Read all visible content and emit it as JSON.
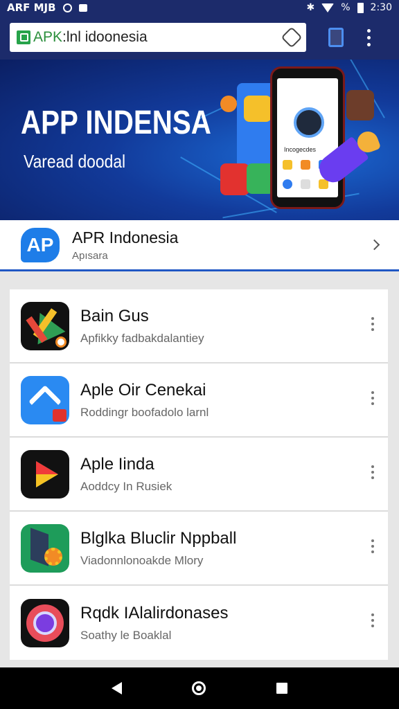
{
  "status": {
    "left_text": "ARF MJB",
    "battery_pct": "%",
    "time": "2:30",
    "icons": [
      "sync-icon",
      "message-icon",
      "bluetooth-icon",
      "wifi-icon",
      "battery-icon"
    ]
  },
  "browser": {
    "url_prefix": "APK",
    "url_text": ":lnl idoonesia",
    "reload_icon": "reload-icon",
    "tabs_icon": "tabs-icon",
    "menu_icon": "more-vertical-icon"
  },
  "hero": {
    "title": "APP INDENSA",
    "subtitle": "Varead doodal",
    "phone_label": "Incogecdes"
  },
  "app_header": {
    "logo_text": "AP",
    "title": "APR Indonesia",
    "subtitle": "Apısara"
  },
  "apps": [
    {
      "title": "Bain Gus",
      "subtitle": "Apfikky fadbakdalantiey",
      "icon": "play-games-icon",
      "colors": [
        "#111111",
        "#f5c02a",
        "#2f9e54",
        "#e5483a"
      ]
    },
    {
      "title": "Aple Oir Cenekai",
      "subtitle": "Roddingr boofadolo larnl",
      "icon": "arrow-up-icon",
      "colors": [
        "#2a8af2",
        "#ffffff",
        "#e0322d"
      ]
    },
    {
      "title": "Aple Iinda",
      "subtitle": "Aoddcy In Rusiek",
      "icon": "play-store-icon",
      "colors": [
        "#111111",
        "#f03a3a",
        "#2eb67a",
        "#f6c224"
      ]
    },
    {
      "title": "Blglka Bluclir Nppball",
      "subtitle": "Viadonnlonoakde Mlory",
      "icon": "gear-icon",
      "colors": [
        "#1e9c5a",
        "#2c3e5c",
        "#f28b25"
      ]
    },
    {
      "title": "Rqdk IAlalirdonases",
      "subtitle": "Soathy le Boaklal",
      "icon": "camera-icon",
      "colors": [
        "#111111",
        "#e84d5a",
        "#7b3de0"
      ]
    }
  ],
  "nav": {
    "back_icon": "back-icon",
    "home_icon": "home-icon",
    "recent_icon": "recent-apps-icon"
  }
}
